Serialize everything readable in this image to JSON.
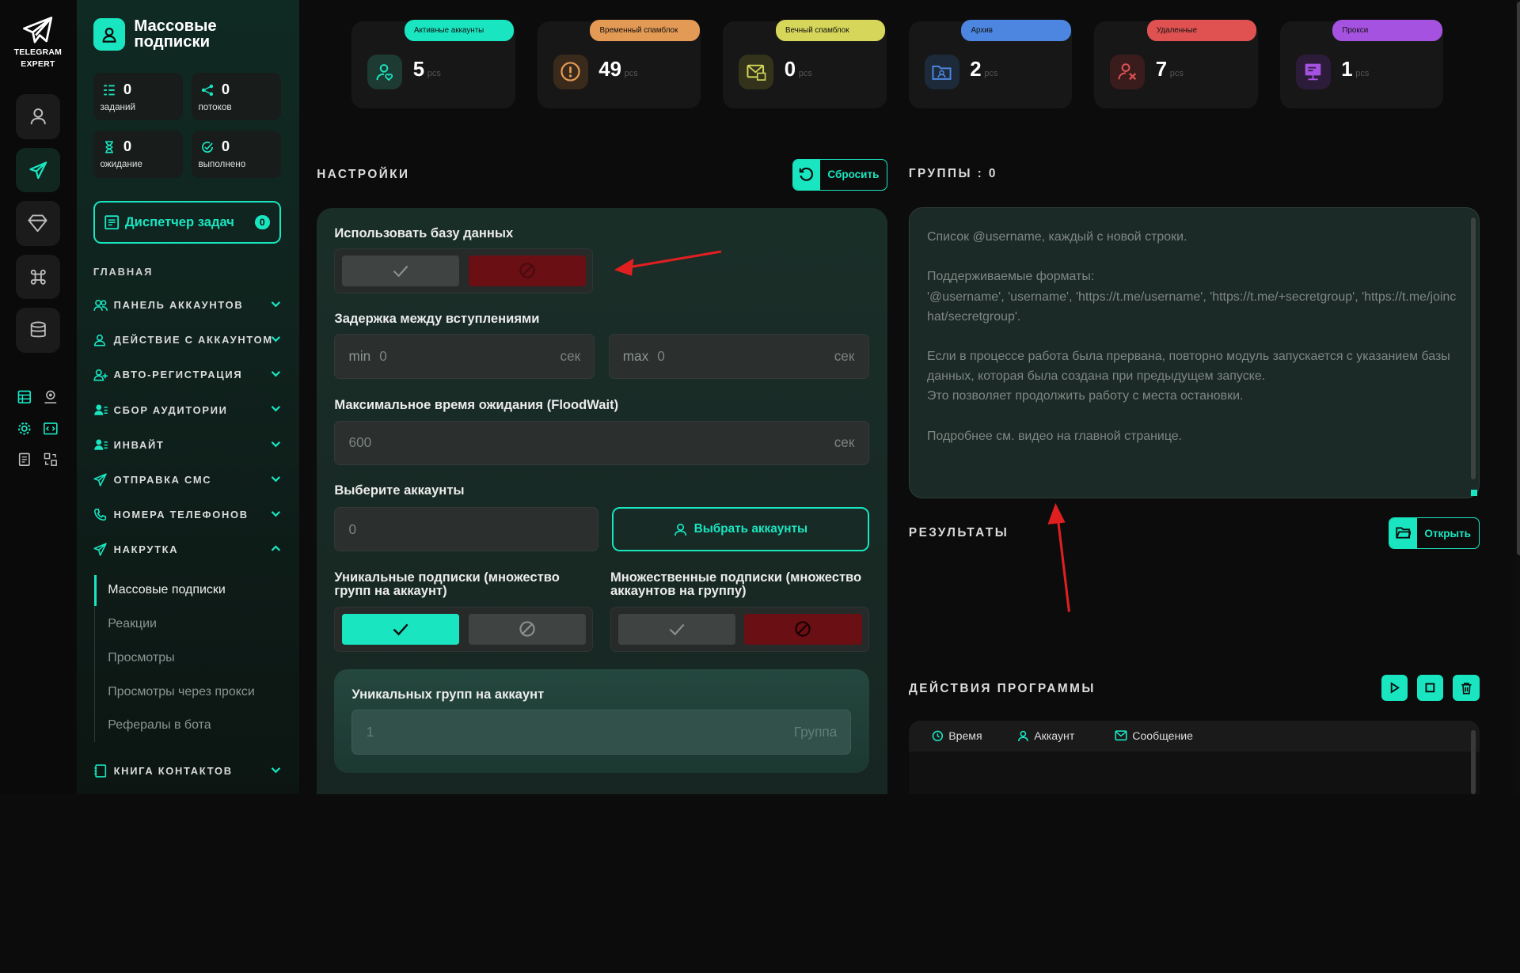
{
  "brand": {
    "name": "TELEGRAM EXPERT"
  },
  "page": {
    "title": "Массовые подписки"
  },
  "stats": [
    {
      "value": "0",
      "label": "заданий",
      "icon": "tasks-icon"
    },
    {
      "value": "0",
      "label": "потоков",
      "icon": "share-icon"
    },
    {
      "value": "0",
      "label": "ожидание",
      "icon": "hourglass-icon"
    },
    {
      "value": "0",
      "label": "выполнено",
      "icon": "check-circle-icon"
    }
  ],
  "dispatcher": {
    "label": "Диспетчер задач",
    "badge": "0"
  },
  "nav": {
    "section": "ГЛАВНАЯ",
    "items": [
      {
        "label": "ПАНЕЛЬ АККАУНТОВ"
      },
      {
        "label": "ДЕЙСТВИЕ С АККАУНТОМ"
      },
      {
        "label": "АВТО-РЕГИСТРАЦИЯ"
      },
      {
        "label": "СБОР АУДИТОРИИ"
      },
      {
        "label": "ИНВАЙТ"
      },
      {
        "label": "ОТПРАВКА СМС"
      },
      {
        "label": "НОМЕРА ТЕЛЕФОНОВ"
      },
      {
        "label": "НАКРУТКА"
      },
      {
        "label": "КНИГА КОНТАКТОВ"
      }
    ],
    "subitems": [
      "Массовые подписки",
      "Реакции",
      "Просмотры",
      "Просмотры через прокси",
      "Рефералы в бота"
    ]
  },
  "cards": [
    {
      "tag": "Активные аккаунты",
      "value": "5",
      "unit": "pcs",
      "color": "#19e6c1"
    },
    {
      "tag": "Временный спамблок",
      "value": "49",
      "unit": "pcs",
      "color": "#e39a55"
    },
    {
      "tag": "Вечный спамблок",
      "value": "0",
      "unit": "pcs",
      "color": "#d6d65a"
    },
    {
      "tag": "Архив",
      "value": "2",
      "unit": "pcs",
      "color": "#4d86e0"
    },
    {
      "tag": "Удаленные",
      "value": "7",
      "unit": "pcs",
      "color": "#e05252"
    },
    {
      "tag": "Прокси",
      "value": "1",
      "unit": "pcs",
      "color": "#a552e0"
    }
  ],
  "settings": {
    "title": "НАСТРОЙКИ",
    "reset": "Сбросить",
    "use_db": "Использовать базу данных",
    "delay": "Задержка между вступлениями",
    "min_prefix": "min",
    "min_value": "0",
    "max_prefix": "max",
    "max_value": "0",
    "sec": "сек",
    "floodwait": "Максимальное время ожидания (FloodWait)",
    "floodwait_value": "600",
    "select_accounts": "Выберите аккаунты",
    "accounts_value": "0",
    "select_btn": "Выбрать аккаунты",
    "unique": "Уникальные подписки (множество групп на аккаунт)",
    "multiple": "Множественные подписки (множество аккаунтов на группу)",
    "unique_groups": "Уникальных групп на аккаунт",
    "unique_groups_placeholder": "1",
    "unique_groups_suffix": "Группа"
  },
  "groups": {
    "title": "ГРУППЫ : 0",
    "placeholder": "Список @username, каждый с новой строки.\n\nПоддерживаемые форматы:\n'@username', 'username', 'https://t.me/username', 'https://t.me/+secretgroup', 'https://t.me/joinchat/secretgroup'.\n\nЕсли в процессе работа была прервана, повторно модуль запускается с указанием базы данных, которая была создана при предыдущем запуске.\nЭто позволяет продолжить работу с места остановки.\n\nПодробнее см. видео на главной странице."
  },
  "results": {
    "title": "РЕЗУЛЬТАТЫ",
    "open": "Открыть"
  },
  "actions": {
    "title": "ДЕЙСТВИЯ ПРОГРАММЫ",
    "cols": [
      "Время",
      "Аккаунт",
      "Сообщение"
    ]
  },
  "colors": {
    "accent": "#19e6c1",
    "danger": "#6a0f14"
  }
}
